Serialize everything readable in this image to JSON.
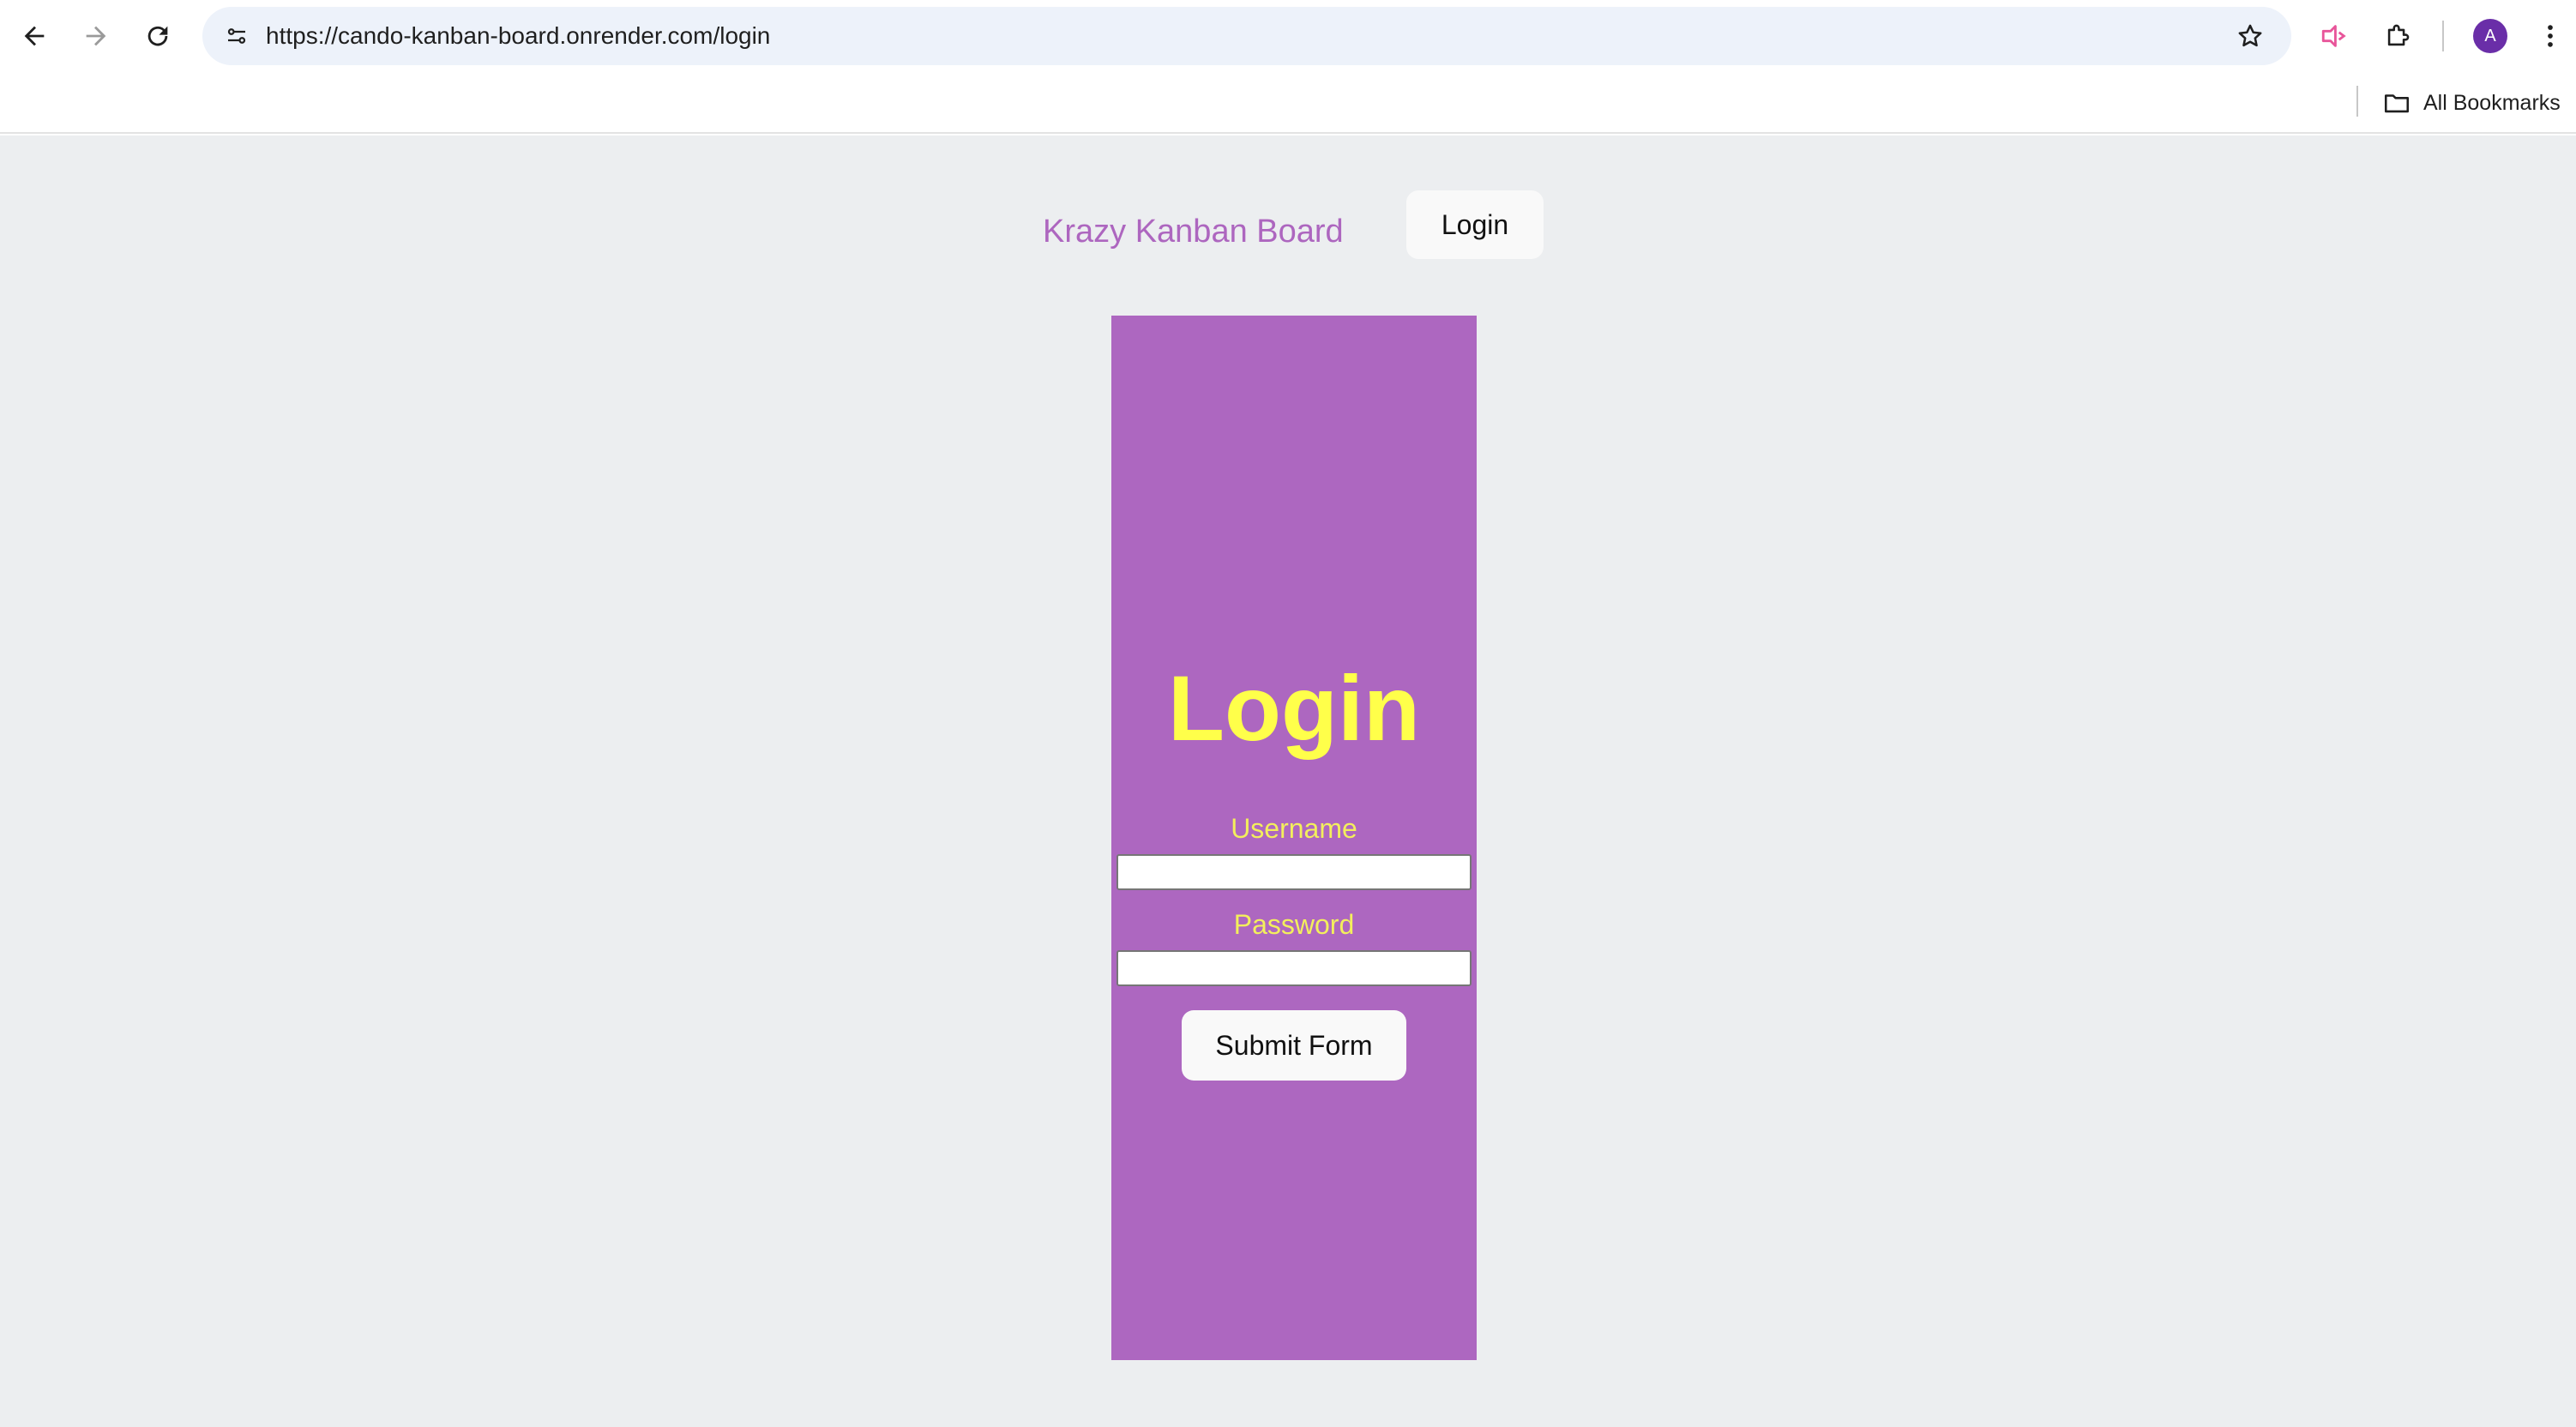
{
  "browser": {
    "url": "https://cando-kanban-board.onrender.com/login",
    "bookmarks_label": "All Bookmarks",
    "profile_initial": "A",
    "icons": [
      "back-arrow-icon",
      "forward-arrow-icon",
      "reload-icon",
      "site-settings-icon",
      "star-icon",
      "cast-icon",
      "extensions-icon",
      "more-vertical-icon",
      "folder-icon"
    ],
    "accent_color": "#6a2ea8"
  },
  "header": {
    "app_title": "Krazy Kanban Board",
    "login_button": "Login"
  },
  "login_form": {
    "heading": "Login",
    "username_label": "Username",
    "username_value": "",
    "password_label": "Password",
    "password_value": "",
    "submit_label": "Submit Form"
  },
  "colors": {
    "page_background": "#eceef0",
    "card_background": "#ad67c0",
    "heading_color": "#ffff4a",
    "title_color": "#ad66bf"
  }
}
